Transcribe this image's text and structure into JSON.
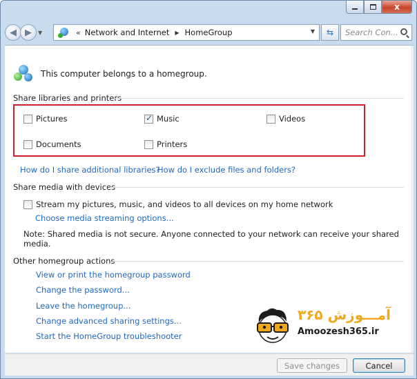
{
  "window": {
    "controls": {
      "close_glyph": "x"
    }
  },
  "navbar": {
    "breadcrumb_prefix": "«",
    "breadcrumbs": [
      "Network and Internet",
      "HomeGroup"
    ],
    "search_placeholder": "Search Con..."
  },
  "homegroup": {
    "status_text": "This computer belongs to a homegroup."
  },
  "share_libraries": {
    "label": "Share libraries and printers",
    "items": [
      {
        "label": "Pictures",
        "checked": false
      },
      {
        "label": "Music",
        "checked": true
      },
      {
        "label": "Videos",
        "checked": false
      },
      {
        "label": "Documents",
        "checked": false
      },
      {
        "label": "Printers",
        "checked": false
      }
    ],
    "links": [
      "How do I share additional libraries?",
      "How do I exclude files and folders?"
    ],
    "highlight_color": "#d0212b"
  },
  "share_media": {
    "label": "Share media with devices",
    "stream_label": "Stream my pictures, music, and videos to all devices on my home network",
    "stream_checked": false,
    "options_link": "Choose media streaming options...",
    "note_line1": "Note: Shared media is not secure. Anyone connected to your network can receive your shared",
    "note_line2": "media."
  },
  "other_actions": {
    "label": "Other homegroup actions",
    "links": [
      "View or print the homegroup password",
      "Change the password...",
      "Leave the homegroup...",
      "Change advanced sharing settings...",
      "Start the HomeGroup troubleshooter"
    ]
  },
  "watermark": {
    "text_fa": "آمـــوزش ۳۶۵",
    "text_en": "Amoozesh365.ir",
    "accent": "#f0a81e"
  },
  "footer": {
    "save_label": "Save changes",
    "save_disabled": true,
    "cancel_label": "Cancel"
  },
  "colors": {
    "link": "#1f68c3",
    "frame": "#c9dcef"
  }
}
